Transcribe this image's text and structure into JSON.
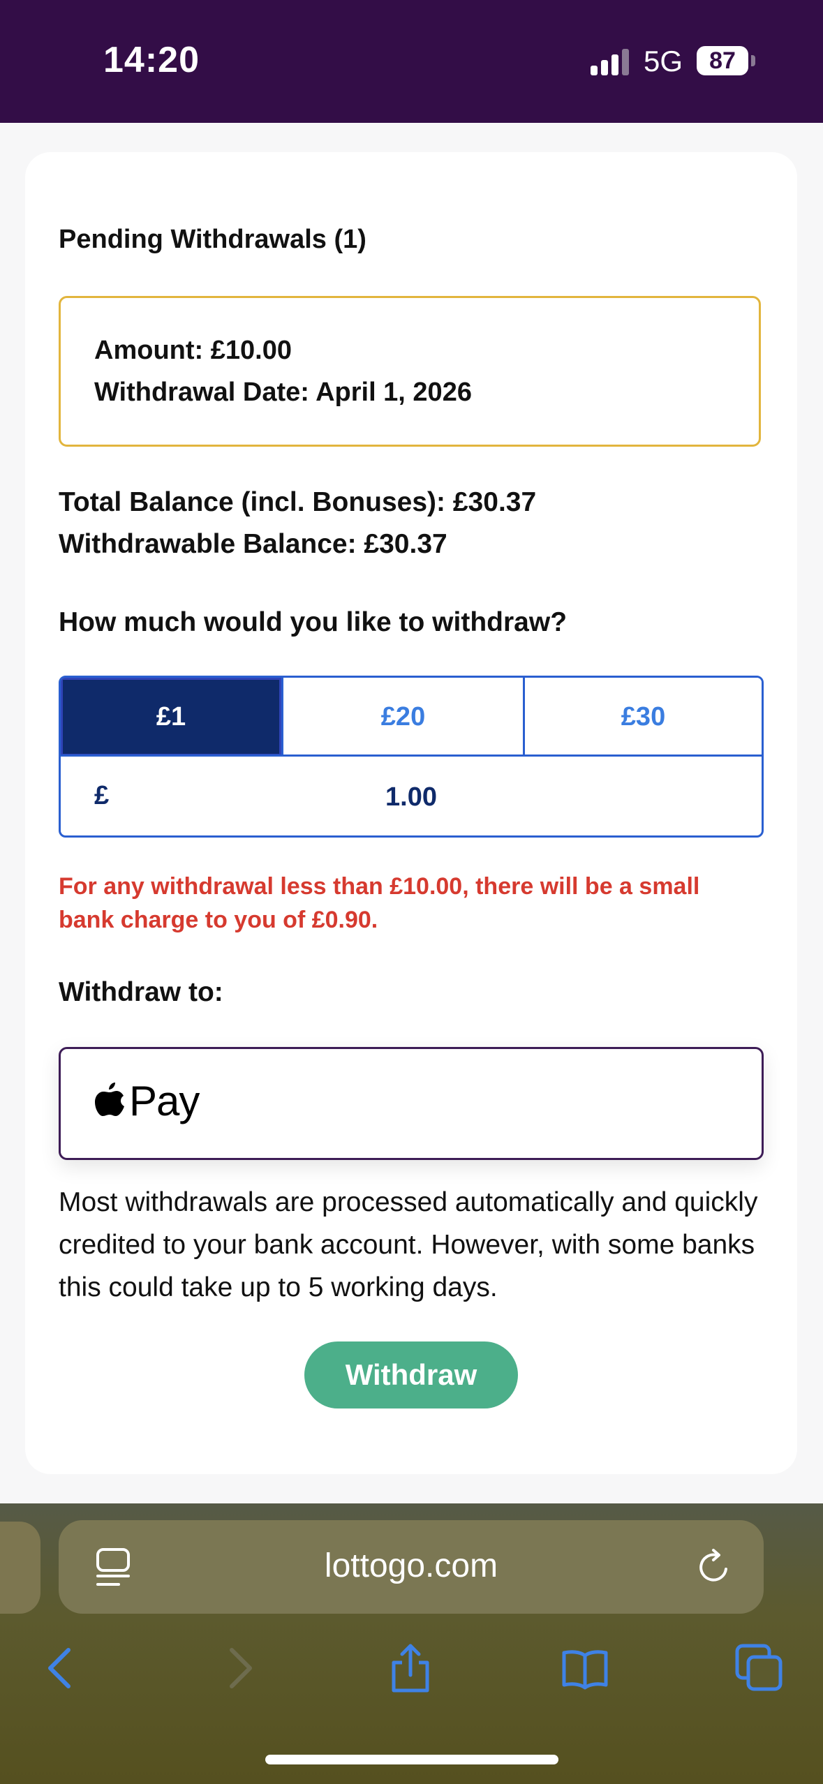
{
  "status_bar": {
    "time": "14:20",
    "network": "5G",
    "battery": "87"
  },
  "pending": {
    "title": "Pending Withdrawals (1)",
    "amount_line": "Amount: £10.00",
    "date_line": "Withdrawal Date: April 1, 2026"
  },
  "balances": {
    "total": "Total Balance (incl. Bonuses): £30.37",
    "withdrawable": "Withdrawable Balance: £30.37"
  },
  "withdraw": {
    "question": "How much would you like to withdraw?",
    "presets": [
      "£1",
      "£20",
      "£30"
    ],
    "selected_preset": "£1",
    "currency_symbol": "£",
    "amount_value": "1.00",
    "warning": "For any withdrawal less than £10.00, there will be a small bank charge to you of £0.90.",
    "withdraw_to_label": "Withdraw to:",
    "method_label": "Pay",
    "info": "Most withdrawals are processed automatically and quickly credited to your bank account. However, with some banks this could take up to 5 working days.",
    "button_label": "Withdraw"
  },
  "browser": {
    "url": "lottogo.com"
  },
  "colors": {
    "header_purple": "#330d47",
    "selected_preset": "#0f2a6a",
    "accent_blue": "#3a7de0",
    "warning_red": "#d63a2f",
    "button_green": "#4caf8a",
    "pending_border": "#e2b53d"
  },
  "icons": [
    "signal-icon",
    "apple-logo-icon",
    "reader-mode-icon",
    "reload-icon",
    "back-icon",
    "forward-icon",
    "share-icon",
    "bookmarks-icon",
    "tabs-icon"
  ]
}
